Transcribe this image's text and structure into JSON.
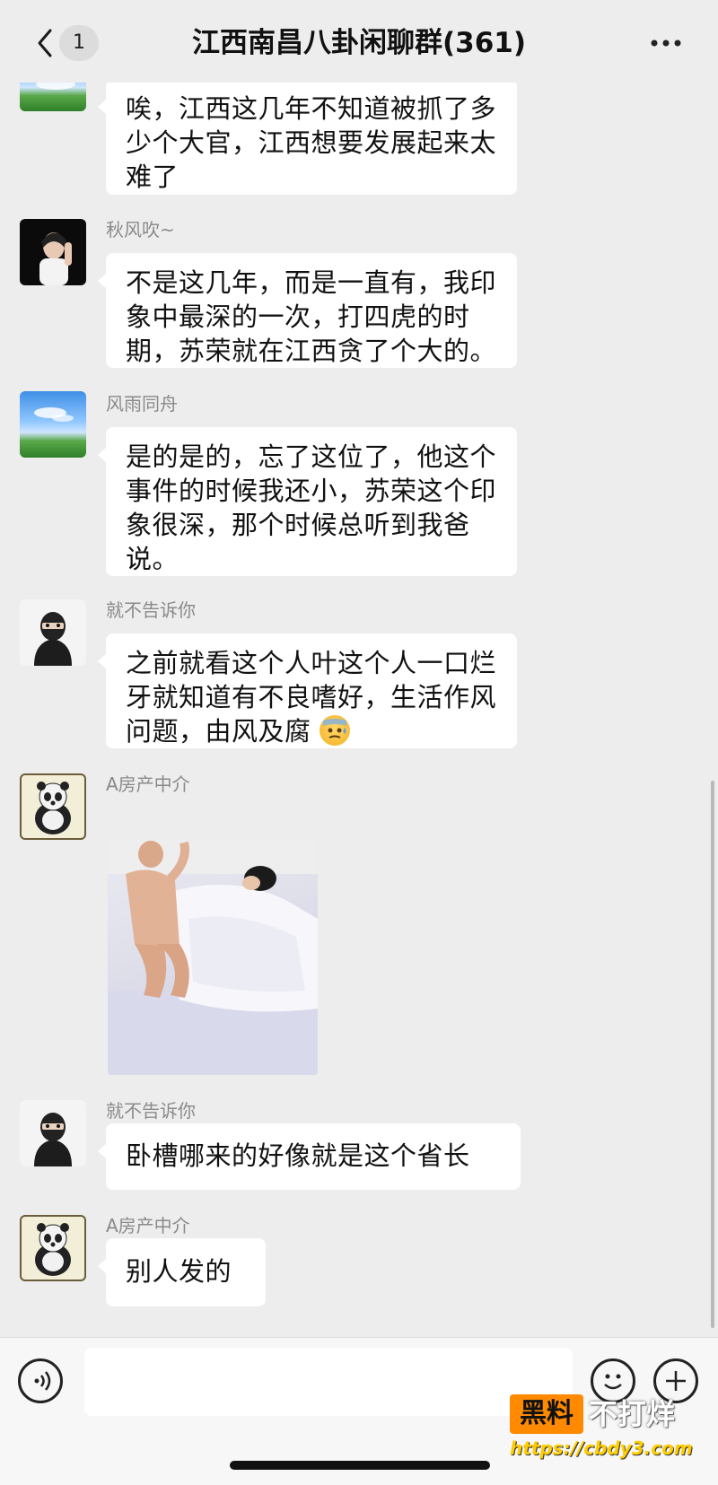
{
  "header": {
    "back_icon": "chevron-left-icon",
    "unread_count": "1",
    "title": "江西南昌八卦闲聊群(361)",
    "more_icon": "more-dots-icon"
  },
  "messages": [
    {
      "sender": "",
      "avatar": "sky-landscape-avatar",
      "text": "唉，江西这几年不知道被抓了多少个大官，江西想要发展起来太难了"
    },
    {
      "sender": "秋风吹~",
      "avatar": "woman-portrait-avatar",
      "text": "不是这几年，而是一直有，我印象中最深的一次，打四虎的时期，苏荣就在江西贪了个大的。"
    },
    {
      "sender": "风雨同舟",
      "avatar": "sky-landscape-avatar",
      "text": "是的是的，忘了这位了，他这个事件的时候我还小，苏荣这个印象很深，那个时候总听到我爸说。"
    },
    {
      "sender": "就不告诉你",
      "avatar": "masked-man-avatar",
      "text": "之前就看这个人叶这个人一口烂牙就知道有不良嗜好，生活作风问题，由风及腐",
      "emoji": "cold-sweat-emoji"
    },
    {
      "sender": "A房产中介",
      "avatar": "panda-avatar",
      "image": "photo-message"
    },
    {
      "sender": "就不告诉你",
      "avatar": "masked-man-avatar",
      "text": "卧槽哪来的好像就是这个省长"
    },
    {
      "sender": "A房产中介",
      "avatar": "panda-avatar",
      "text": "别人发的"
    }
  ],
  "input_bar": {
    "voice_icon": "voice-icon",
    "emoji_icon": "emoji-icon",
    "plus_icon": "plus-icon",
    "input_value": ""
  },
  "watermark": {
    "brand_left": "黑料",
    "brand_right": "不打烊",
    "url": "https://cbdy3.com"
  },
  "colors": {
    "background": "#ededed",
    "bubble": "#ffffff",
    "watermark_orange": "#ff8a00"
  }
}
